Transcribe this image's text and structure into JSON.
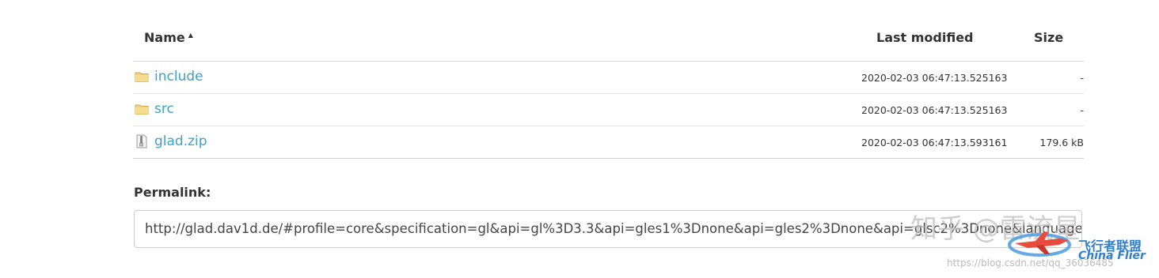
{
  "header": {
    "name_label": "Name",
    "sort_icon": "caret-up-icon",
    "modified_label": "Last modified",
    "size_label": "Size"
  },
  "rows": [
    {
      "name": "include",
      "icon": "folder-icon",
      "modified": "2020-02-03 06:47:13.525163",
      "size": "-"
    },
    {
      "name": "src",
      "icon": "folder-icon",
      "modified": "2020-02-03 06:47:13.525163",
      "size": "-"
    },
    {
      "name": "glad.zip",
      "icon": "zip-file-icon",
      "modified": "2020-02-03 06:47:13.593161",
      "size": "179.6 kB"
    }
  ],
  "permalink": {
    "label": "Permalink:",
    "value": "http://glad.dav1d.de/#profile=core&specification=gl&api=gl%3D3.3&api=gles1%3Dnone&api=gles2%3Dnone&api=glsc2%3Dnone&language"
  },
  "watermark": {
    "zhihu": "知乎 @雷流星",
    "brand_cn": "飞行者联盟",
    "brand_en": "China Flier",
    "blog": "https://blog.csdn.net/qq_36036485"
  },
  "colors": {
    "link": "#3fa0c8",
    "folder": "#e8c56a",
    "brand": "#2e7fd0"
  }
}
